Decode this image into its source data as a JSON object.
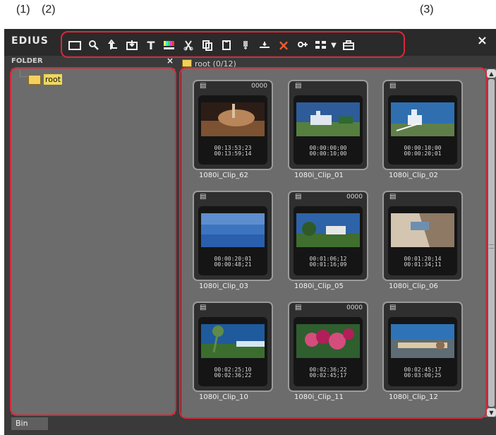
{
  "callouts": {
    "folder": "(1)",
    "toolbar": "(2)",
    "clips": "(3)"
  },
  "window": {
    "app_name": "EDIUS",
    "close_symbol": "×",
    "toolbar_items": [
      {
        "icon": "folder-outline-icon"
      },
      {
        "icon": "search-icon"
      },
      {
        "icon": "up-folder-icon"
      },
      {
        "icon": "import-icon"
      },
      {
        "icon": "text-icon",
        "label": "T"
      },
      {
        "icon": "color-bars-icon"
      },
      {
        "icon": "cut-icon"
      },
      {
        "icon": "copy-icon"
      },
      {
        "icon": "paste-icon"
      },
      {
        "icon": "insert-icon"
      },
      {
        "icon": "overwrite-icon"
      },
      {
        "icon": "delete-icon",
        "label": "×"
      },
      {
        "icon": "properties-icon"
      },
      {
        "icon": "view-icon"
      },
      {
        "icon": "dropdown-arrow-icon"
      },
      {
        "icon": "briefcase-icon"
      }
    ]
  },
  "folder_panel": {
    "title": "FOLDER",
    "close_symbol": "×",
    "tree": [
      {
        "label": "root"
      }
    ]
  },
  "bin": {
    "header": "root (0/12)",
    "clips": [
      {
        "name": "1080i_Clip_62",
        "time_in": "00:13:53;23",
        "time_out": "00:13:59;14",
        "audio": "0000",
        "thumb_colors": [
          "#2d1d17",
          "#7c5232",
          "#b8865a"
        ]
      },
      {
        "name": "1080i_Clip_01",
        "time_in": "00:00:00;00",
        "time_out": "00:00:10;00",
        "audio": "",
        "thumb_colors": [
          "#2e5b99",
          "#dfe6ef",
          "#557f3f"
        ]
      },
      {
        "name": "1080i_Clip_02",
        "time_in": "00:00:10;00",
        "time_out": "00:00:20;01",
        "audio": "",
        "thumb_colors": [
          "#2f6fb0",
          "#e8eef4",
          "#5f7f4a"
        ]
      },
      {
        "name": "1080i_Clip_03",
        "time_in": "00:00:20;01",
        "time_out": "00:00:48;21",
        "audio": "",
        "thumb_colors": [
          "#5e8ecd",
          "#3d74c0",
          "#2a5fae"
        ]
      },
      {
        "name": "1080i_Clip_05",
        "time_in": "00:01:06;12",
        "time_out": "00:01:16;09",
        "audio": "0000",
        "thumb_colors": [
          "#2e63a7",
          "#e6e6e6",
          "#3f6e2e"
        ]
      },
      {
        "name": "1080i_Clip_06",
        "time_in": "00:01:20;14",
        "time_out": "00:01:34;11",
        "audio": "",
        "thumb_colors": [
          "#d4c5b1",
          "#6f8fb0",
          "#8d7964"
        ]
      },
      {
        "name": "1080i_Clip_10",
        "time_in": "00:02:25;10",
        "time_out": "00:02:36;22",
        "audio": "",
        "thumb_colors": [
          "#1f5a9d",
          "#5e8b4a",
          "#3b6e2e"
        ]
      },
      {
        "name": "1080i_Clip_11",
        "time_in": "00:02:36;22",
        "time_out": "00:02:45;17",
        "audio": "0000",
        "thumb_colors": [
          "#b21e59",
          "#2f5e2f",
          "#d44d7c"
        ]
      },
      {
        "name": "1080i_Clip_12",
        "time_in": "00:02:45;17",
        "time_out": "00:03:00;25",
        "audio": "",
        "thumb_colors": [
          "#2f73b6",
          "#dcc9a6",
          "#5e6c73"
        ]
      }
    ],
    "scroll_up": "▲",
    "scroll_down": "▼"
  },
  "bottom_tab": {
    "label": "Bin"
  },
  "colors": {
    "highlight": "#d8283a",
    "background": "#6c6c6c",
    "dark": "#2a2a2a"
  }
}
